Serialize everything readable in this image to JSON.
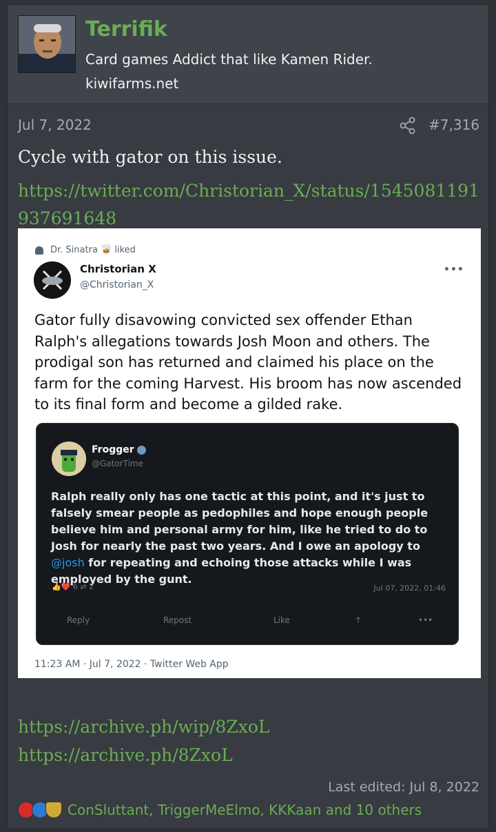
{
  "user": {
    "name": "Terrifik",
    "title": "Card games Addict that like Kamen Rider.",
    "site": "kiwifarms.net"
  },
  "post": {
    "date": "Jul 7, 2022",
    "number": "#7,316",
    "text": "Cycle with gator on this issue.",
    "link1": "https://twitter.com/Christorian_X/status/1545081191937691648",
    "link2": "https://archive.ph/wip/8ZxoL",
    "link3": "https://archive.ph/8ZxoL",
    "last_edited": "Last edited: Jul 8, 2022",
    "reaction_names": "ConSluttant, TriggerMeElmo, KKKaan and 10 others"
  },
  "tweet": {
    "liked_by": "Dr. Sinatra 🥃 liked",
    "name": "Christorian X",
    "handle": "@Christorian_X",
    "more": "•••",
    "text": "Gator fully disavowing convicted sex offender Ethan Ralph's allegations towards Josh Moon and others. The prodigal son has returned and claimed his place on the farm for the coming Harvest. His broom has now ascended to its final form and become a gilded rake.",
    "footer": "11:23 AM · Jul 7, 2022 · Twitter Web App"
  },
  "quote": {
    "name": "Frogger",
    "handle": "@GatorTime",
    "text_before": "Ralph really only has one tactic at this point, and it's just to falsely smear people as pedophiles and hope enough people believe him and personal army for him, like he tried to do to Josh for nearly the past two years. And I owe an apology to ",
    "mention": "@josh",
    "text_after": " for repeating and echoing those attacks while I was employed by the gunt.",
    "reacts": "👍❤️ 6  ⇄ 2",
    "date": "Jul 07, 2022, 01:46",
    "actions": {
      "reply": "Reply",
      "repost": "Repost",
      "like": "Like",
      "share": "↑",
      "more": "•••"
    }
  }
}
